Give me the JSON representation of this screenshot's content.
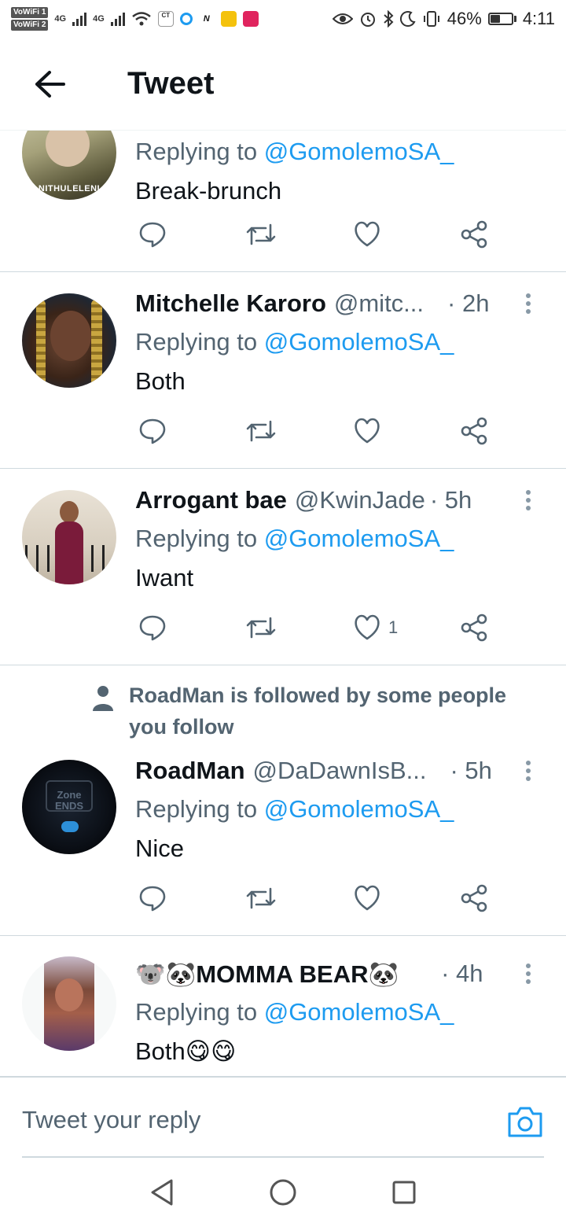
{
  "status_bar": {
    "wifi_badges": [
      "VoWiFi 1",
      "VoWiFi 2"
    ],
    "signal_labels": [
      "4G",
      "4G"
    ],
    "battery_percent": "46%",
    "battery_level": 0.46,
    "time": "4:11",
    "app_icons": [
      "cape-talk-icon",
      "o-icon",
      "n-icon",
      "camera-app-icon",
      "red-app-icon"
    ]
  },
  "header": {
    "back_icon": "arrow-left-icon",
    "title": "Tweet"
  },
  "replies": [
    {
      "name": "",
      "handle": "",
      "time": "",
      "replying_prefix": "Replying to ",
      "mention": "@GomolemoSA_",
      "text": "Break-brunch",
      "avatar_label": "NITHULELENI",
      "like_count": ""
    },
    {
      "name": "Mitchelle Karoro",
      "handle": "@mitc...",
      "time": "· 2h",
      "replying_prefix": "Replying to ",
      "mention": "@GomolemoSA_",
      "text": "Both",
      "like_count": ""
    },
    {
      "name": "Arrogant bae",
      "handle": "@KwinJade",
      "time": "· 5h",
      "replying_prefix": "Replying to ",
      "mention": "@GomolemoSA_",
      "text": "Iwant",
      "like_count": "1"
    },
    {
      "social_context": "RoadMan is followed by some people you follow",
      "name": "RoadMan",
      "handle": "@DaDawnIsB...",
      "time": "· 5h",
      "replying_prefix": "Replying to ",
      "mention": "@GomolemoSA_",
      "text": "Nice",
      "avatar_label": "Zone ENDS",
      "like_count": ""
    },
    {
      "name": "🐨🐼MOMMA BEAR🐼",
      "handle": "",
      "time": "· 4h",
      "replying_prefix": "Replying to ",
      "mention": "@GomolemoSA_",
      "text": "Both😋😋",
      "like_count": ""
    }
  ],
  "composer": {
    "placeholder": "Tweet your reply",
    "camera_icon": "camera-icon"
  },
  "nav": {
    "icons": [
      "back-triangle-icon",
      "home-circle-icon",
      "recents-square-icon"
    ]
  },
  "colors": {
    "accent": "#1d9bf0",
    "secondary_text": "#536471",
    "primary_text": "#0f1419",
    "divider": "#cfd9de"
  }
}
